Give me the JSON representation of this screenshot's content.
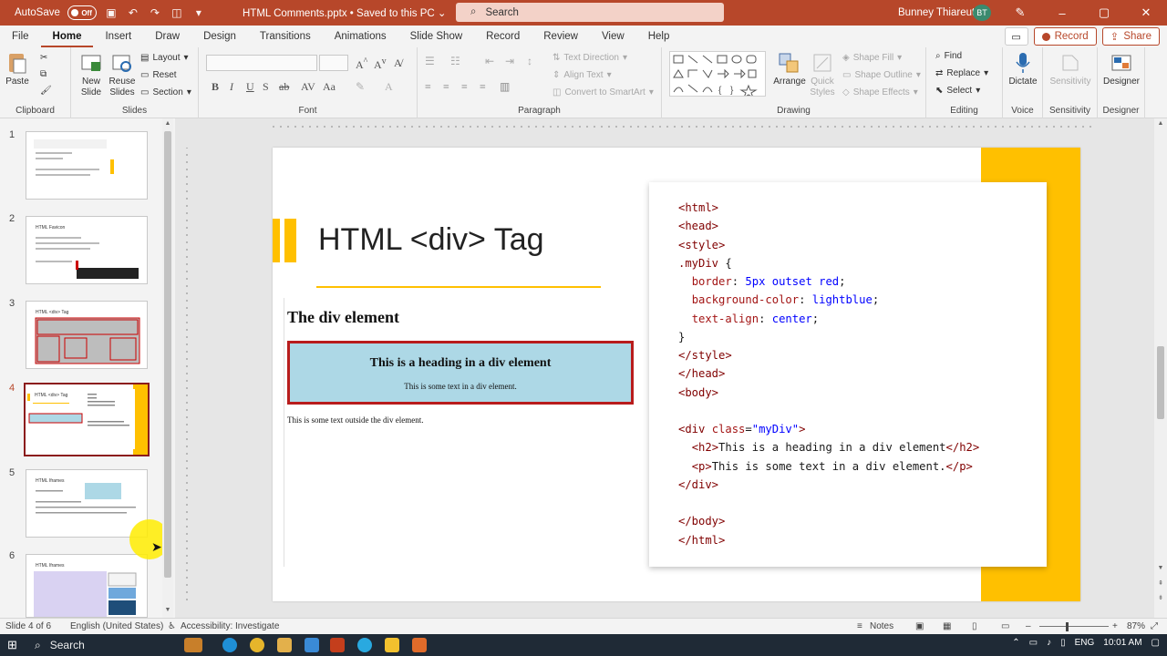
{
  "titlebar": {
    "autosave_label": "AutoSave",
    "autosave_state": "Off",
    "doc_title": "HTML Comments.pptx • Saved to this PC ⌄",
    "search_placeholder": "Search",
    "user_name": "Bunney Thiareuth",
    "user_initials": "BT"
  },
  "tabs": [
    "File",
    "Home",
    "Insert",
    "Draw",
    "Design",
    "Transitions",
    "Animations",
    "Slide Show",
    "Record",
    "Review",
    "View",
    "Help"
  ],
  "active_tab": "Home",
  "tab_right": {
    "record": "Record",
    "share": "Share"
  },
  "ribbon": {
    "clipboard": {
      "paste": "Paste",
      "label": "Clipboard"
    },
    "slides": {
      "new_slide": "New Slide",
      "reuse_slides": "Reuse Slides",
      "layout": "Layout",
      "reset": "Reset",
      "section": "Section",
      "label": "Slides"
    },
    "font": {
      "label": "Font"
    },
    "paragraph": {
      "text_direction": "Text Direction",
      "align_text": "Align Text",
      "convert_smartart": "Convert to SmartArt",
      "label": "Paragraph"
    },
    "drawing": {
      "arrange": "Arrange",
      "quick_styles": "Quick Styles",
      "shape_fill": "Shape Fill",
      "shape_outline": "Shape Outline",
      "shape_effects": "Shape Effects",
      "label": "Drawing"
    },
    "editing": {
      "find": "Find",
      "replace": "Replace",
      "select": "Select",
      "label": "Editing"
    },
    "voice": {
      "dictate": "Dictate",
      "label": "Voice"
    },
    "sensitivity": {
      "btn": "Sensitivity",
      "label": "Sensitivity"
    },
    "designer": {
      "btn": "Designer",
      "label": "Designer"
    }
  },
  "thumbnails": [
    {
      "num": "1",
      "title": "HTML Comments"
    },
    {
      "num": "2",
      "title": "HTML Favicon"
    },
    {
      "num": "3",
      "title": "HTML <div> Tag"
    },
    {
      "num": "4",
      "title": "HTML <div> Tag"
    },
    {
      "num": "5",
      "title": "HTML Iframes"
    },
    {
      "num": "6",
      "title": "HTML Iframes"
    }
  ],
  "slide": {
    "title": "HTML <div> Tag",
    "demo_heading": "The div element",
    "div_heading": "This is a heading in a div element",
    "div_text": "This is some text in a div element.",
    "outside_text": "This is some text outside the div element."
  },
  "statusbar": {
    "slide_info": "Slide 4 of 6",
    "language": "English (United States)",
    "accessibility": "Accessibility: Investigate",
    "notes": "Notes",
    "zoom": "87%"
  },
  "taskbar": {
    "search": "Search",
    "lang": "ENG",
    "time": "10:01 AM"
  },
  "colors": {
    "brand": "#b7472a",
    "accent_yellow": "#ffc000",
    "div_border": "#b81c1c",
    "div_bg": "lightblue"
  }
}
